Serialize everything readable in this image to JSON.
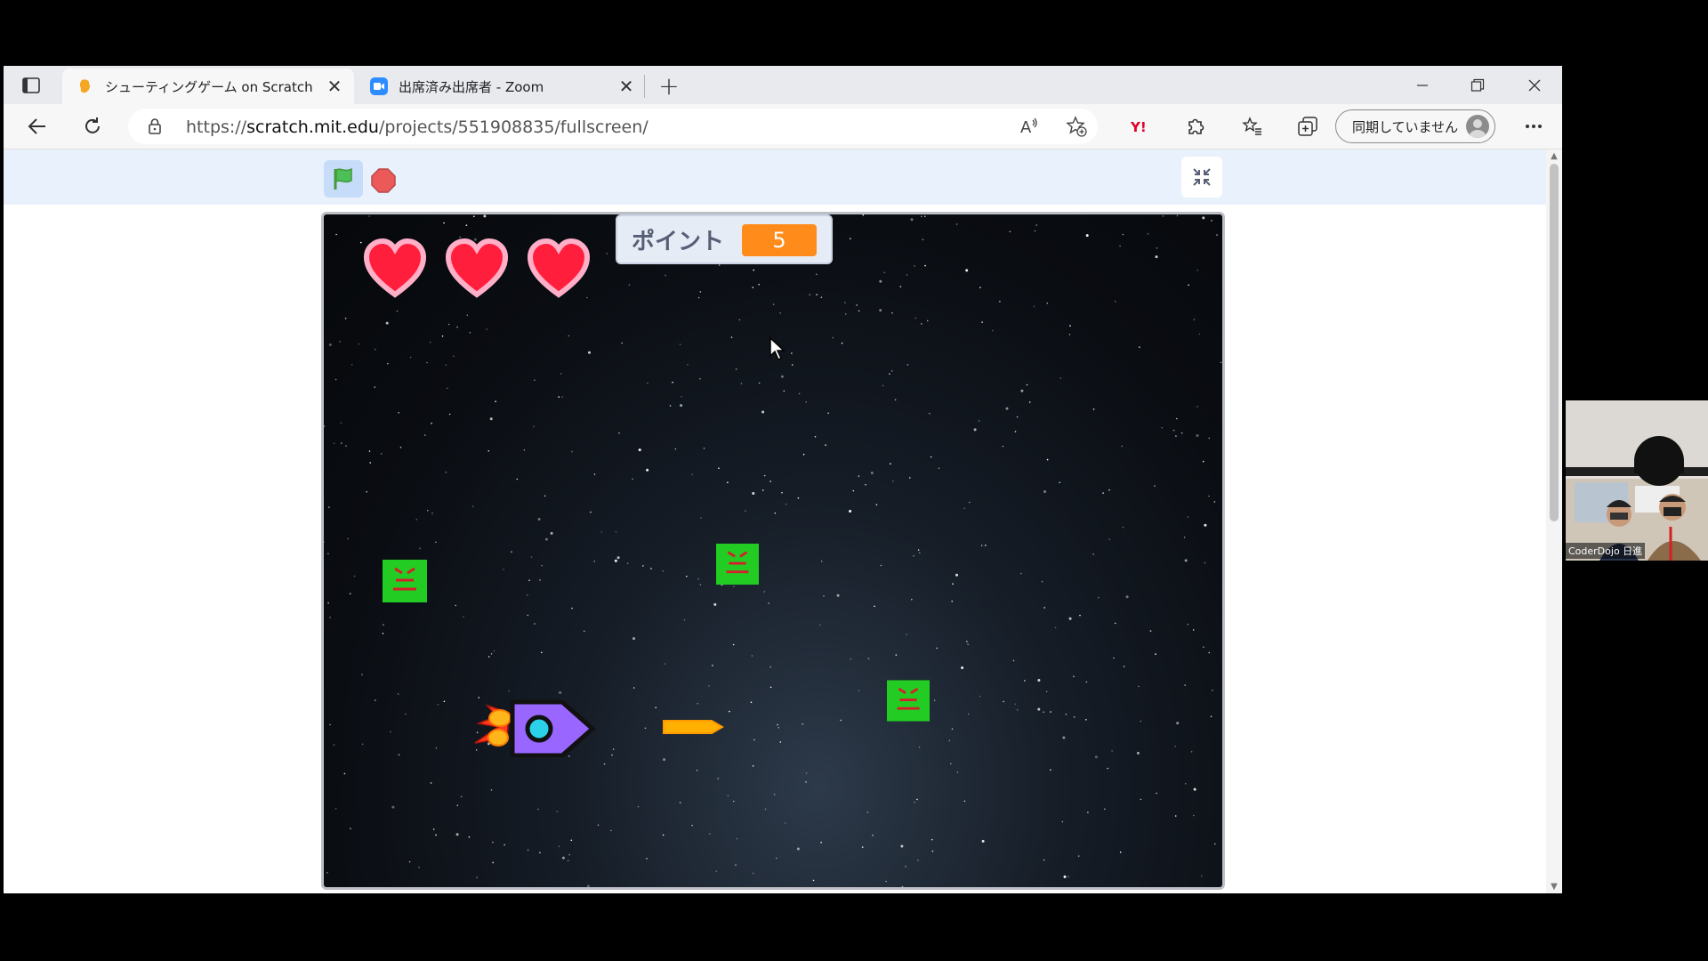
{
  "browser": {
    "tabs": [
      {
        "title": "シューティングゲーム on Scratch",
        "active": true
      },
      {
        "title": "出席済み出席者 - Zoom",
        "active": false
      }
    ],
    "address": {
      "url_prefix": "https://",
      "url_host": "scratch.mit.edu",
      "url_path": "/projects/551908835/fullscreen/"
    },
    "profile_label": "同期していません"
  },
  "game": {
    "lives": 3,
    "score_label": "ポイント",
    "score_value": "5",
    "enemies": 3
  },
  "video": {
    "participant_name": "CoderDojo 日進"
  },
  "colors": {
    "scratch_bar": "#e9f1fc",
    "monitor_value": "#ff8c1a",
    "enemy": "#22cc22",
    "heart": "#ff1f3d"
  }
}
